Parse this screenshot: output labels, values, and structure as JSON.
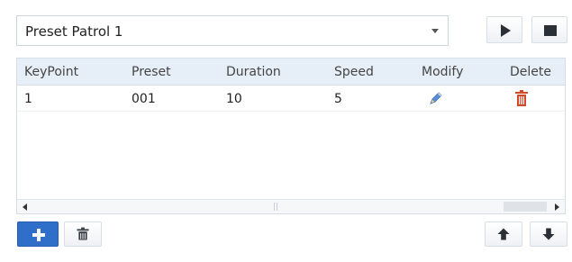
{
  "patrol_select": {
    "selected": "Preset Patrol 1"
  },
  "controls": {
    "play_icon": "play-icon",
    "stop_icon": "stop-icon"
  },
  "table": {
    "columns": [
      "KeyPoint",
      "Preset",
      "Duration",
      "Speed",
      "Modify",
      "Delete"
    ],
    "rows": [
      {
        "keypoint": "1",
        "preset": "001",
        "duration": "10",
        "speed": "5",
        "modify_icon": "pencil-icon",
        "delete_icon": "trash-icon"
      }
    ]
  },
  "toolbar": {
    "add_icon": "plus-icon",
    "delete_icon": "trash-icon",
    "move_up_icon": "arrow-up-icon",
    "move_down_icon": "arrow-down-icon"
  },
  "colors": {
    "accent_blue": "#2f6fca",
    "header_bg": "#e6eff8",
    "pencil_blue": "#5a8fd6",
    "trash_red": "#d04a2a"
  }
}
